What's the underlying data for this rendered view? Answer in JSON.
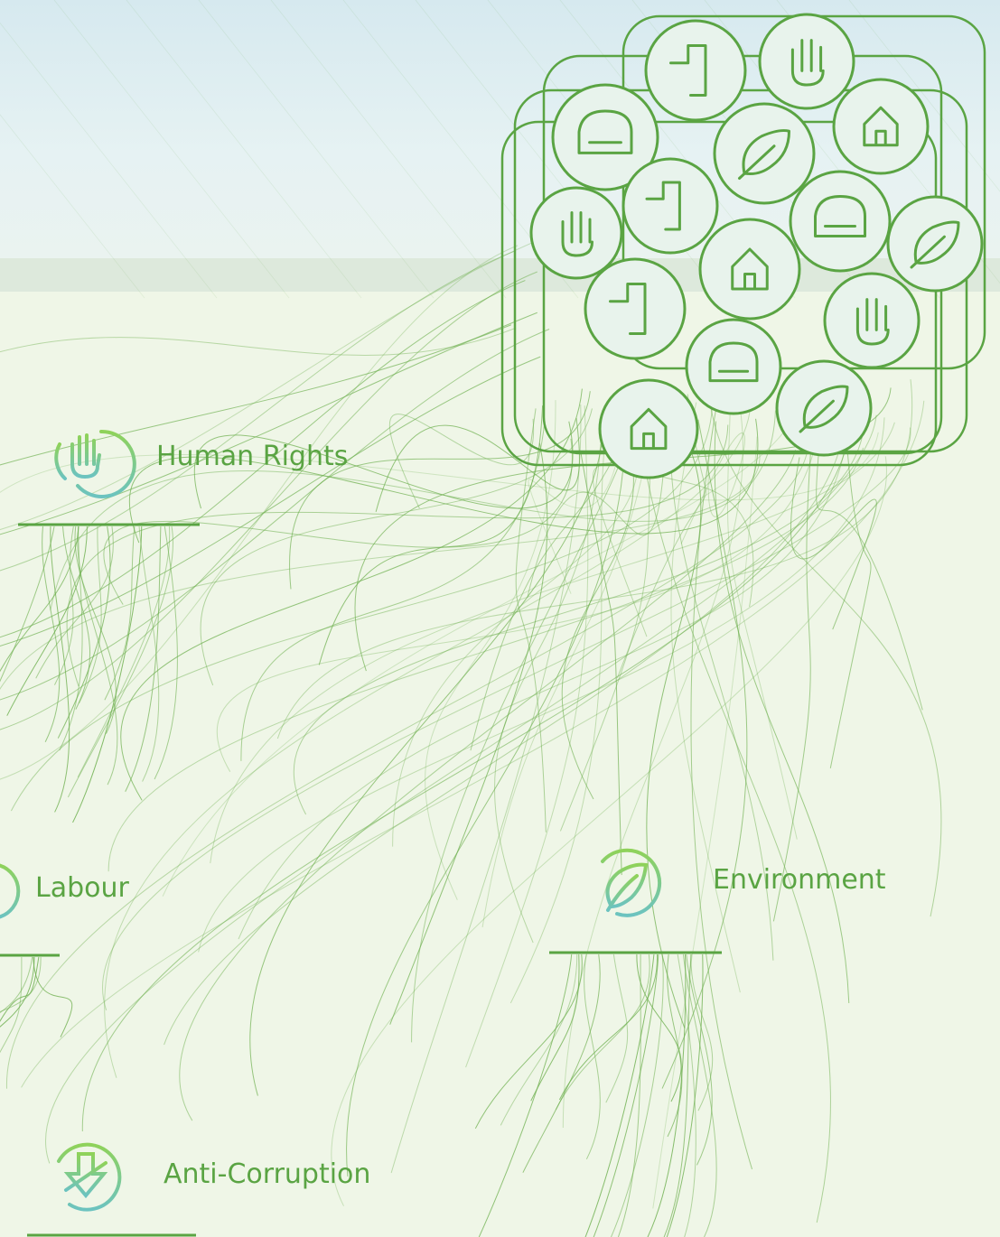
{
  "colors": {
    "accent": "#5aa443",
    "accent_dark": "#56a03f",
    "icon_gradient_start": "#8fd25a",
    "icon_gradient_end": "#6cc3c0",
    "sky": "#dceef2",
    "ground": "#eff6e7"
  },
  "categories": [
    {
      "key": "human_rights",
      "label": "Human Rights",
      "icon": "raised-hand-icon"
    },
    {
      "key": "labour",
      "label": "Labour",
      "icon": "hand-icon"
    },
    {
      "key": "environment",
      "label": "Environment",
      "icon": "leaf-icon"
    },
    {
      "key": "anti_corruption",
      "label": "Anti-Corruption",
      "icon": "down-arrow-icon"
    }
  ],
  "cluster_icons": [
    "minus-one-icon",
    "hand-icon",
    "stairs-icon",
    "raised-hand-icon",
    "down-arrow-icon",
    "fuel-pump-icon",
    "oil-barrel-icon",
    "leaf-icon",
    "light-bulb-icon",
    "factory-icon",
    "car-icon",
    "plug-icon",
    "box-icon",
    "recycle-icon",
    "house-icon"
  ]
}
